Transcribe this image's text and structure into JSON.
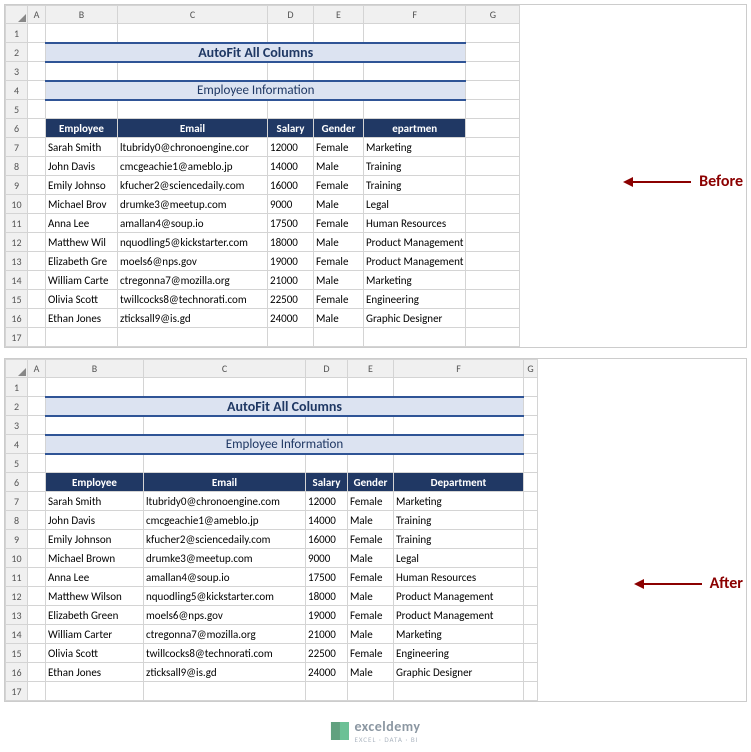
{
  "columns": [
    "A",
    "B",
    "C",
    "D",
    "E",
    "F",
    "G"
  ],
  "rows": [
    1,
    2,
    3,
    4,
    5,
    6,
    7,
    8,
    9,
    10,
    11,
    12,
    13,
    14,
    15,
    16,
    17
  ],
  "title": "AutoFit All Columns",
  "subtitle": "Employee Information",
  "header": {
    "employee": "Employee",
    "email": "Email",
    "salary": "Salary",
    "gender": "Gender",
    "department_trunc": "epartmen",
    "department": "Department"
  },
  "employees": [
    {
      "name": "Sarah Smith",
      "name_trunc": "Sarah Smith",
      "email": "ltubridy0@chronoengine.com",
      "email_trunc": "ltubridy0@chronoengine.cor",
      "salary": "12000",
      "gender": "Female",
      "dept": "Marketing"
    },
    {
      "name": "John Davis",
      "name_trunc": "John Davis",
      "email": "cmcgeachie1@ameblo.jp",
      "email_trunc": "cmcgeachie1@ameblo.jp",
      "salary": "14000",
      "gender": "Male",
      "dept": "Training"
    },
    {
      "name": "Emily Johnson",
      "name_trunc": "Emily Johnso",
      "email": "kfucher2@sciencedaily.com",
      "email_trunc": "kfucher2@sciencedaily.com",
      "salary": "16000",
      "gender": "Female",
      "dept": "Training"
    },
    {
      "name": "Michael Brown",
      "name_trunc": "Michael Brov",
      "email": "drumke3@meetup.com",
      "email_trunc": "drumke3@meetup.com",
      "salary": "9000",
      "gender": "Male",
      "dept": "Legal"
    },
    {
      "name": "Anna Lee",
      "name_trunc": "Anna Lee",
      "email": "amallan4@soup.io",
      "email_trunc": "amallan4@soup.io",
      "salary": "17500",
      "gender": "Female",
      "dept": "Human Resources"
    },
    {
      "name": "Matthew Wilson",
      "name_trunc": "Matthew Wil",
      "email": "nquodling5@kickstarter.com",
      "email_trunc": "nquodling5@kickstarter.com",
      "salary": "18000",
      "gender": "Male",
      "dept": "Product Management"
    },
    {
      "name": "Elizabeth Green",
      "name_trunc": "Elizabeth Gre",
      "email": "moels6@nps.gov",
      "email_trunc": "moels6@nps.gov",
      "salary": "19000",
      "gender": "Female",
      "dept": "Product Management"
    },
    {
      "name": "William Carter",
      "name_trunc": "William Carte",
      "email": "ctregonna7@mozilla.org",
      "email_trunc": "ctregonna7@mozilla.org",
      "salary": "21000",
      "gender": "Male",
      "dept": "Marketing"
    },
    {
      "name": "Olivia Scott",
      "name_trunc": "Olivia Scott",
      "email": "twillcocks8@technorati.com",
      "email_trunc": "twillcocks8@technorati.com",
      "salary": "22500",
      "gender": "Female",
      "dept": "Engineering"
    },
    {
      "name": "Ethan Jones",
      "name_trunc": "Ethan Jones",
      "email": "zticksall9@is.gd",
      "email_trunc": "zticksall9@is.gd",
      "salary": "24000",
      "gender": "Male",
      "dept": "Graphic Designer"
    }
  ],
  "labels": {
    "before": "Before",
    "after": "After"
  },
  "brand": {
    "name": "exceldemy",
    "sub": "EXCEL · DATA · BI"
  },
  "before_widths": {
    "A": 18,
    "B": 72,
    "C": 150,
    "D": 46,
    "E": 50,
    "F": 60,
    "G": 54
  },
  "after_widths": {
    "A": 18,
    "B": 98,
    "C": 162,
    "D": 42,
    "E": 46,
    "F": 130,
    "G": 14
  }
}
